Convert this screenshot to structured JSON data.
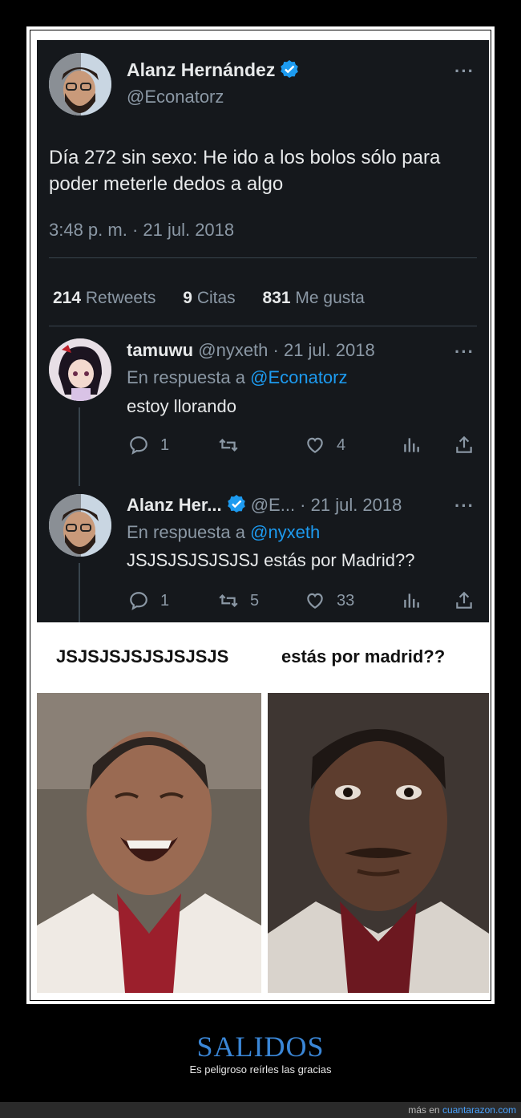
{
  "main_tweet": {
    "author_name": "Alanz Hernández",
    "handle": "@Econatorz",
    "text": "Día 272 sin sexo: He ido a los bolos sólo para poder meterle dedos a algo",
    "timestamp": "3:48 p. m. · 21 jul. 2018",
    "stats": {
      "retweets_count": "214",
      "retweets_label": "Retweets",
      "quotes_count": "9",
      "quotes_label": "Citas",
      "likes_count": "831",
      "likes_label": "Me gusta"
    },
    "more_label": "···"
  },
  "replies": [
    {
      "author_name": "tamuwu",
      "handle_date": "@nyxeth · 21 jul. 2018",
      "reply_to_prefix": "En respuesta a",
      "reply_to_handle": "@Econatorz",
      "text": "estoy llorando",
      "reply_count": "1",
      "retweet_count": "",
      "like_count": "4",
      "more_label": "···"
    },
    {
      "author_name": "Alanz Her...",
      "handle_date": "@E... · 21 jul. 2018",
      "reply_to_prefix": "En respuesta a",
      "reply_to_handle": "@nyxeth",
      "text": "JSJSJSJSJSJSJ estás por Madrid??",
      "reply_count": "1",
      "retweet_count": "5",
      "like_count": "33",
      "more_label": "···"
    }
  ],
  "meme": {
    "left_caption": "JSJSJSJSJSJSJSJS",
    "right_caption": "estás por madrid??"
  },
  "footer": {
    "title": "SALIDOS",
    "subtitle": "Es peligroso reírles las gracias",
    "more_prefix": "más en",
    "site": "cuantarazon.com"
  },
  "colors": {
    "panel_bg": "#15181c",
    "text": "#e7e9ea",
    "muted": "#8b98a5",
    "link": "#1d9bf0",
    "footer_title": "#3a86d6"
  }
}
